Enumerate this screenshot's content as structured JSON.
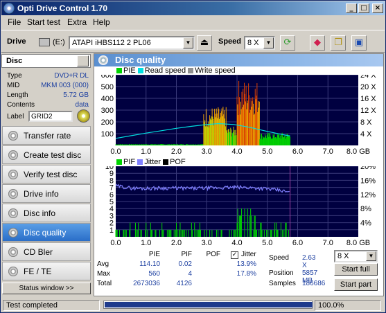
{
  "window": {
    "title": "Opti Drive Control 1.70"
  },
  "menu": [
    "File",
    "Start test",
    "Extra",
    "Help"
  ],
  "toolbar": {
    "drive_label": "Drive",
    "drive_letter": "(E:)",
    "drive_name": "ATAPI iHBS112   2 PL06",
    "speed_label": "Speed",
    "speed_value": "8 X"
  },
  "disc": {
    "header": "Disc",
    "rows": [
      {
        "key": "Type",
        "value": "DVD+R DL"
      },
      {
        "key": "MID",
        "value": "MKM 003 (000)"
      },
      {
        "key": "Length",
        "value": "5.72 GB"
      },
      {
        "key": "Contents",
        "value": "data"
      }
    ],
    "label_key": "Label",
    "label_value": "GRID2"
  },
  "nav": [
    {
      "label": "Transfer rate",
      "active": false
    },
    {
      "label": "Create test disc",
      "active": false
    },
    {
      "label": "Verify test disc",
      "active": false
    },
    {
      "label": "Drive info",
      "active": false
    },
    {
      "label": "Disc info",
      "active": false
    },
    {
      "label": "Disc quality",
      "active": true
    },
    {
      "label": "CD Bler",
      "active": false
    },
    {
      "label": "FE / TE",
      "active": false
    }
  ],
  "status_window_label": "Status window >>",
  "panel_title": "Disc quality",
  "chart_data": [
    {
      "type": "bar",
      "legend": [
        "PIE",
        "Read speed",
        "Write speed"
      ],
      "colors": {
        "PIE": "#00d400",
        "Read speed": "#00e0e0",
        "Write speed": "#909090"
      },
      "x_ticks": [
        "0.0",
        "1.0",
        "2.0",
        "3.0",
        "4.0",
        "5.0",
        "6.0",
        "7.0",
        "8.0 GB"
      ],
      "xlim": [
        0,
        8
      ],
      "y_left_ticks": [
        "100",
        "200",
        "300",
        "400",
        "500",
        "600"
      ],
      "ylim_left": [
        0,
        600
      ],
      "y_right_ticks": [
        "4 X",
        "8 X",
        "12 X",
        "16 X",
        "20 X",
        "24 X"
      ],
      "ylim_right": [
        0,
        24
      ],
      "pie_segments": [
        {
          "x0": 0.0,
          "x1": 2.9,
          "peak": 12
        },
        {
          "x0": 2.9,
          "x1": 3.65,
          "peak": 330
        },
        {
          "x0": 3.65,
          "x1": 4.0,
          "peak": 160
        },
        {
          "x0": 4.0,
          "x1": 4.75,
          "peak": 560
        },
        {
          "x0": 4.75,
          "x1": 5.75,
          "peak": 110
        }
      ],
      "read_speed": [
        [
          0.0,
          2.4
        ],
        [
          0.5,
          3.3
        ],
        [
          1.0,
          4.2
        ],
        [
          1.5,
          5.0
        ],
        [
          2.0,
          5.8
        ],
        [
          2.5,
          6.5
        ],
        [
          3.0,
          7.1
        ],
        [
          3.4,
          7.4
        ],
        [
          3.9,
          7.1
        ],
        [
          4.4,
          6.2
        ],
        [
          4.9,
          5.0
        ],
        [
          5.4,
          3.9
        ],
        [
          5.75,
          3.2
        ]
      ]
    },
    {
      "type": "bar",
      "legend": [
        "PIF",
        "Jitter",
        "POF"
      ],
      "colors": {
        "PIF": "#00d400",
        "Jitter": "#8080ff",
        "POF": "#000000"
      },
      "x_ticks": [
        "0.0",
        "1.0",
        "2.0",
        "3.0",
        "4.0",
        "5.0",
        "6.0",
        "7.0",
        "8.0 GB"
      ],
      "xlim": [
        0,
        8
      ],
      "y_left_ticks": [
        "1",
        "2",
        "3",
        "4",
        "5",
        "6",
        "7",
        "8",
        "9",
        "10"
      ],
      "ylim_left": [
        0,
        10
      ],
      "y_right_ticks": [
        "4%",
        "8%",
        "12%",
        "16%",
        "20%"
      ],
      "ylim_right": [
        0,
        20
      ],
      "pif_max": 4,
      "jitter": [
        [
          0.0,
          14.4
        ],
        [
          0.5,
          13.8
        ],
        [
          1.0,
          13.7
        ],
        [
          1.5,
          13.8
        ],
        [
          2.0,
          13.8
        ],
        [
          2.5,
          13.7
        ],
        [
          3.0,
          13.8
        ],
        [
          3.5,
          13.9
        ],
        [
          4.0,
          14.0
        ],
        [
          4.5,
          13.9
        ],
        [
          5.0,
          13.6
        ],
        [
          5.5,
          13.0
        ],
        [
          5.75,
          12.5
        ]
      ]
    }
  ],
  "stats": {
    "col_headers": [
      "PIE",
      "PIF",
      "POF"
    ],
    "jitter_label": "Jitter",
    "jitter_checked": "✓",
    "rows": [
      {
        "label": "Avg",
        "pie": "114.10",
        "pif": "0.02",
        "pof": "",
        "jitter": "13.9%"
      },
      {
        "label": "Max",
        "pie": "560",
        "pif": "4",
        "pof": "",
        "jitter": "17.8%"
      },
      {
        "label": "Total",
        "pie": "2673036",
        "pif": "4126",
        "pof": "",
        "jitter": ""
      }
    ],
    "speed_label": "Speed",
    "speed_value": "2.63 X",
    "position_label": "Position",
    "position_value": "5857 MB",
    "samples_label": "Samples",
    "samples_value": "186686",
    "speed_select": "8 X",
    "start_full": "Start full",
    "start_part": "Start part"
  },
  "status": {
    "text": "Test completed",
    "progress": 1.0,
    "progress_text": "100.0%"
  }
}
